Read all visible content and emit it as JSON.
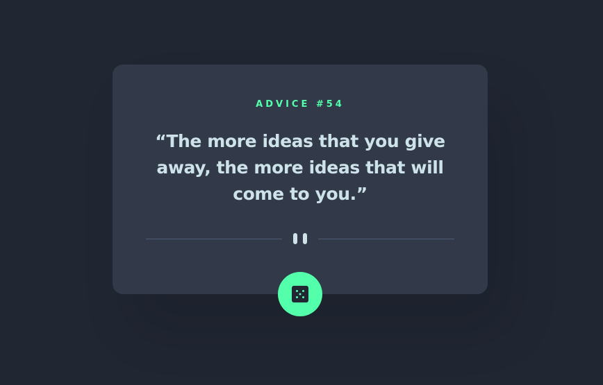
{
  "advice": {
    "label": "Advice #54",
    "quote": "“The more ideas that you give away, the more ideas that will come to you.”"
  },
  "divider": {
    "icon": "pause-icon"
  },
  "action": {
    "icon": "dice-icon"
  },
  "colors": {
    "background": "#202632",
    "card": "#323a49",
    "accent": "#53ffaa",
    "text": "#cee3e9",
    "divider": "#4f5d74"
  }
}
